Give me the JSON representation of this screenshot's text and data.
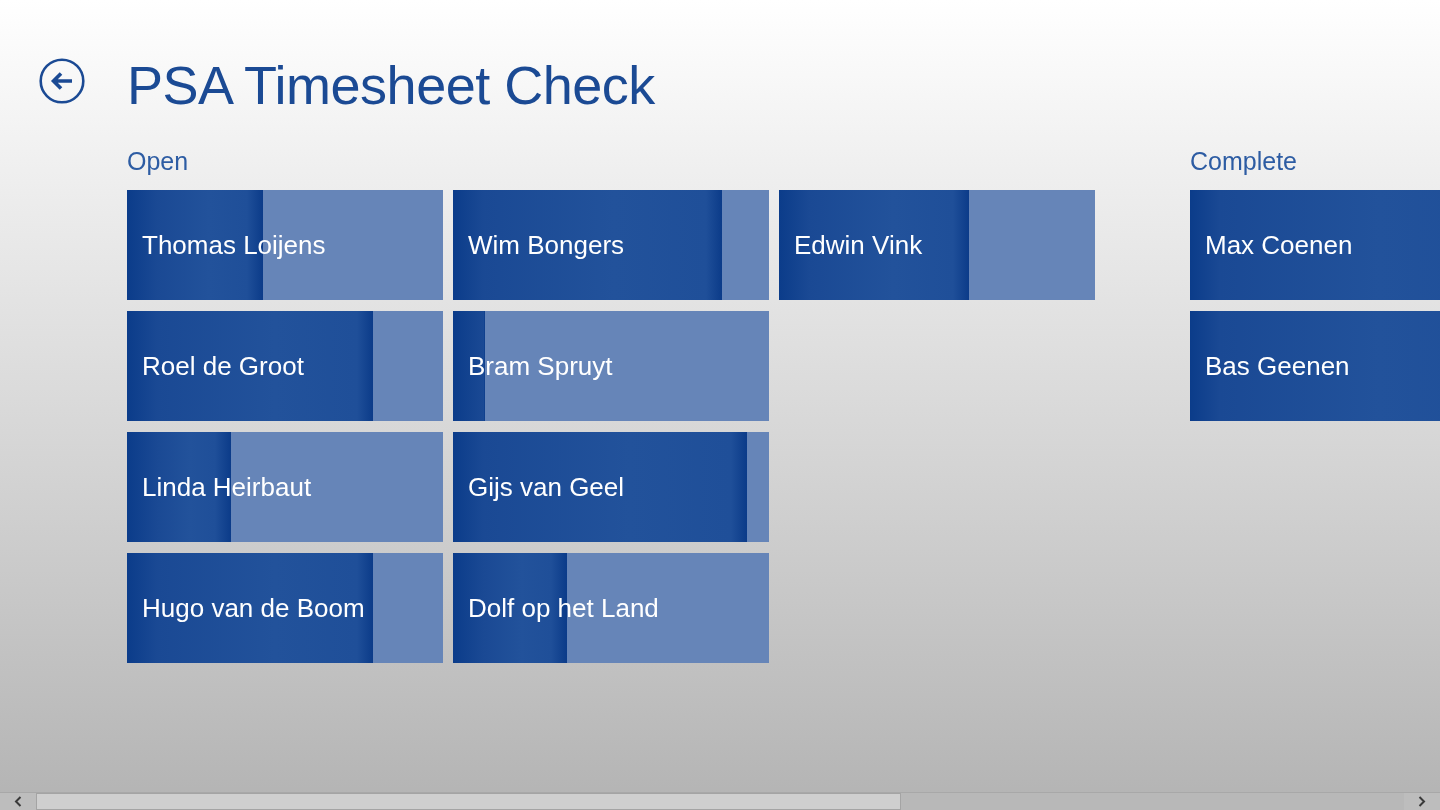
{
  "page": {
    "title": "PSA Timesheet Check"
  },
  "groups": [
    {
      "header": "Open",
      "tiles": [
        {
          "name": "Thomas Loijens",
          "level": 0.43
        },
        {
          "name": "Roel de Groot",
          "level": 0.78
        },
        {
          "name": "Linda Heirbaut",
          "level": 0.33
        },
        {
          "name": "Hugo van de Boom",
          "level": 0.78
        },
        {
          "name": "Wim Bongers",
          "level": 0.85
        },
        {
          "name": "Bram Spruyt",
          "level": 0.1
        },
        {
          "name": "Gijs van Geel",
          "level": 0.93
        },
        {
          "name": "Dolf op het Land",
          "level": 0.36
        },
        {
          "name": "Edwin Vink",
          "level": 0.6
        }
      ]
    },
    {
      "header": "Complete",
      "tiles": [
        {
          "name": "Max Coenen",
          "level": 1
        },
        {
          "name": "Bas Geenen",
          "level": 1
        }
      ]
    }
  ]
}
